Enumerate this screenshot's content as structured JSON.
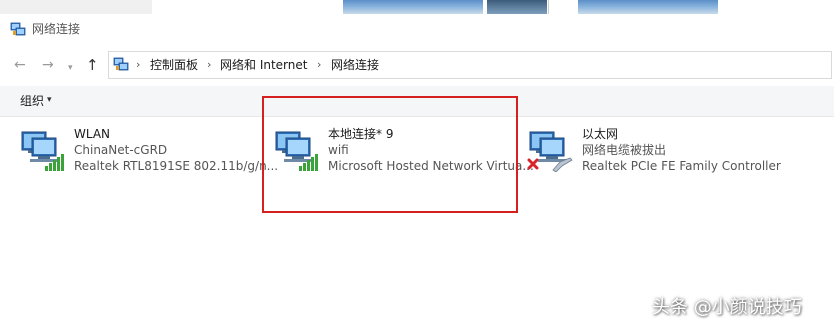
{
  "window": {
    "title": "网络连接"
  },
  "navigation": {
    "back_icon": "arrow-left-icon",
    "forward_icon": "arrow-right-icon",
    "history_icon": "chevron-down-icon",
    "up_icon": "arrow-up-icon",
    "breadcrumb": [
      {
        "label": "控制面板"
      },
      {
        "label": "网络和 Internet"
      },
      {
        "label": "网络连接"
      }
    ],
    "separator": "›"
  },
  "toolbar": {
    "organize_label": "组织",
    "organize_caret": "▾"
  },
  "connections": [
    {
      "name": "WLAN",
      "status": "ChinaNet-cGRD",
      "device": "Realtek RTL8191SE 802.11b/g/n...",
      "icon": "wireless-network-icon"
    },
    {
      "name": "本地连接* 9",
      "status": "wifi",
      "device": "Microsoft Hosted Network Virtua...",
      "icon": "wireless-network-icon"
    },
    {
      "name": "以太网",
      "status": "网络电缆被拔出",
      "device": "Realtek PCIe FE Family Controller",
      "icon": "ethernet-disconnected-icon"
    }
  ],
  "watermark": {
    "text": "头条 @小颜说技巧"
  },
  "colors": {
    "highlight_border": "#d62020",
    "toolbar_bg": "#f5f6f7",
    "signal_green": "#3aa33a",
    "disconnected_red": "#d9232b"
  }
}
